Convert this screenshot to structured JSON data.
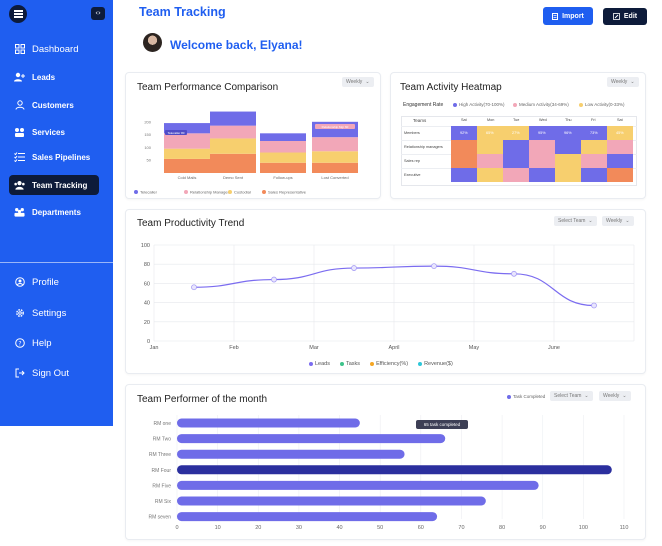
{
  "app": {
    "brand": "Team Tracking",
    "welcome": "Welcome back, Elyana!",
    "import_label": "Import",
    "edit_label": "Edit"
  },
  "sidebar": {
    "items": [
      {
        "label": "Dashboard",
        "icon": "grid-icon"
      },
      {
        "label": "Leads",
        "icon": "user-plus-icon"
      },
      {
        "label": "Customers",
        "icon": "user-icon"
      },
      {
        "label": "Services",
        "icon": "services-icon"
      },
      {
        "label": "Sales Pipelines",
        "icon": "pipeline-icon"
      },
      {
        "label": "Team Tracking",
        "icon": "team-icon",
        "active": true
      },
      {
        "label": "Departments",
        "icon": "departments-icon"
      }
    ],
    "bottom": [
      {
        "label": "Profile",
        "icon": "profile-icon"
      },
      {
        "label": "Settings",
        "icon": "gear-icon"
      },
      {
        "label": "Help",
        "icon": "help-icon"
      },
      {
        "label": "Sign Out",
        "icon": "sign-out-icon"
      }
    ]
  },
  "comparison": {
    "title": "Team Performance Comparison",
    "period": "Weekly",
    "y_ticks": [
      "200",
      "150",
      "100",
      "50"
    ],
    "categories": [
      "Cold Mails",
      "Demo Sent",
      "Follow-ups",
      "Lost Converted"
    ],
    "legend": [
      {
        "label": "Telecaller",
        "color": "#6f6ce8"
      },
      {
        "label": "Relationship Manager",
        "color": "#f2a7b8"
      },
      {
        "label": "Custodial",
        "color": "#f7cf6e"
      },
      {
        "label": "Sales Representative",
        "color": "#f28a5a"
      }
    ],
    "tooltip_1": "Telecaller 80",
    "tooltip_2": "Relationship Mgr 60"
  },
  "heatmap": {
    "title": "Team Activity Heatmap",
    "period": "Weekly",
    "rate_label": "Engagement Rate",
    "legend": [
      {
        "label": "High Activity(70-100%)",
        "color": "#6f6ce8"
      },
      {
        "label": "Medium Activity(34-69%)",
        "color": "#f2a7b8"
      },
      {
        "label": "Low Activity(0-33%)",
        "color": "#f7cf6e"
      }
    ],
    "header": "Teams",
    "days": [
      "Sat",
      "Mon",
      "Tue",
      "Wed",
      "Thu",
      "Fri",
      "Sat"
    ],
    "rows": [
      "Members",
      "Relationship managers",
      "Sales rep",
      "Executive"
    ],
    "percents": [
      "92%",
      "65%",
      "27%",
      "95%",
      "96%",
      "73%",
      "45%"
    ]
  },
  "productivity": {
    "title": "Team Productivity Trend",
    "select_team": "Select Team",
    "period": "Weekly",
    "legend": [
      {
        "label": "Leads",
        "color": "#7b6cf0"
      },
      {
        "label": "Tasks",
        "color": "#3ec38b"
      },
      {
        "label": "Efficiency(%)",
        "color": "#f5a623"
      },
      {
        "label": "Revenue($)",
        "color": "#2ec7d9"
      }
    ]
  },
  "performer": {
    "title": "Team Performer of the month",
    "legend_label": "Task Completed",
    "select_team": "Select Team",
    "period": "Weekly",
    "tooltip": "65 task completed"
  },
  "chart_data": [
    {
      "type": "bar",
      "title": "Team Performance Comparison",
      "categories": [
        "Cold Mails",
        "Demo Sent",
        "Follow-ups",
        "Lost Converted"
      ],
      "stacked": true,
      "ylim": [
        0,
        250
      ],
      "series": [
        {
          "name": "Telecaller",
          "values": [
            40,
            55,
            30,
            60
          ]
        },
        {
          "name": "Relationship Manager",
          "values": [
            60,
            50,
            45,
            55
          ]
        },
        {
          "name": "Custodial",
          "values": [
            40,
            60,
            40,
            45
          ]
        },
        {
          "name": "Sales Representative",
          "values": [
            55,
            75,
            40,
            40
          ]
        }
      ]
    },
    {
      "type": "line",
      "title": "Team Productivity Trend",
      "categories": [
        "Jan",
        "Feb",
        "Mar",
        "April",
        "May",
        "June"
      ],
      "ylim": [
        0,
        100
      ],
      "y_ticks": [
        0,
        20,
        40,
        60,
        80,
        100
      ],
      "points": [
        {
          "x": "Jan-mid",
          "y": 56
        },
        {
          "x": "Feb-mid",
          "y": 64
        },
        {
          "x": "Mar-mid",
          "y": 76
        },
        {
          "x": "Apr-mid",
          "y": 78
        },
        {
          "x": "May-mid",
          "y": 70
        },
        {
          "x": "June-mid",
          "y": 37
        }
      ]
    },
    {
      "type": "bar",
      "orientation": "horizontal",
      "title": "Team Performer of the month",
      "categories": [
        "RM one",
        "RM Two",
        "RM Three",
        "RM Four",
        "RM Five",
        "RM Six",
        "RM seven"
      ],
      "values": [
        45,
        66,
        56,
        107,
        89,
        76,
        64
      ],
      "xlim": [
        0,
        110
      ],
      "x_ticks": [
        0,
        10,
        20,
        30,
        40,
        50,
        60,
        70,
        80,
        90,
        100,
        110
      ],
      "highlight": "RM Four"
    }
  ]
}
